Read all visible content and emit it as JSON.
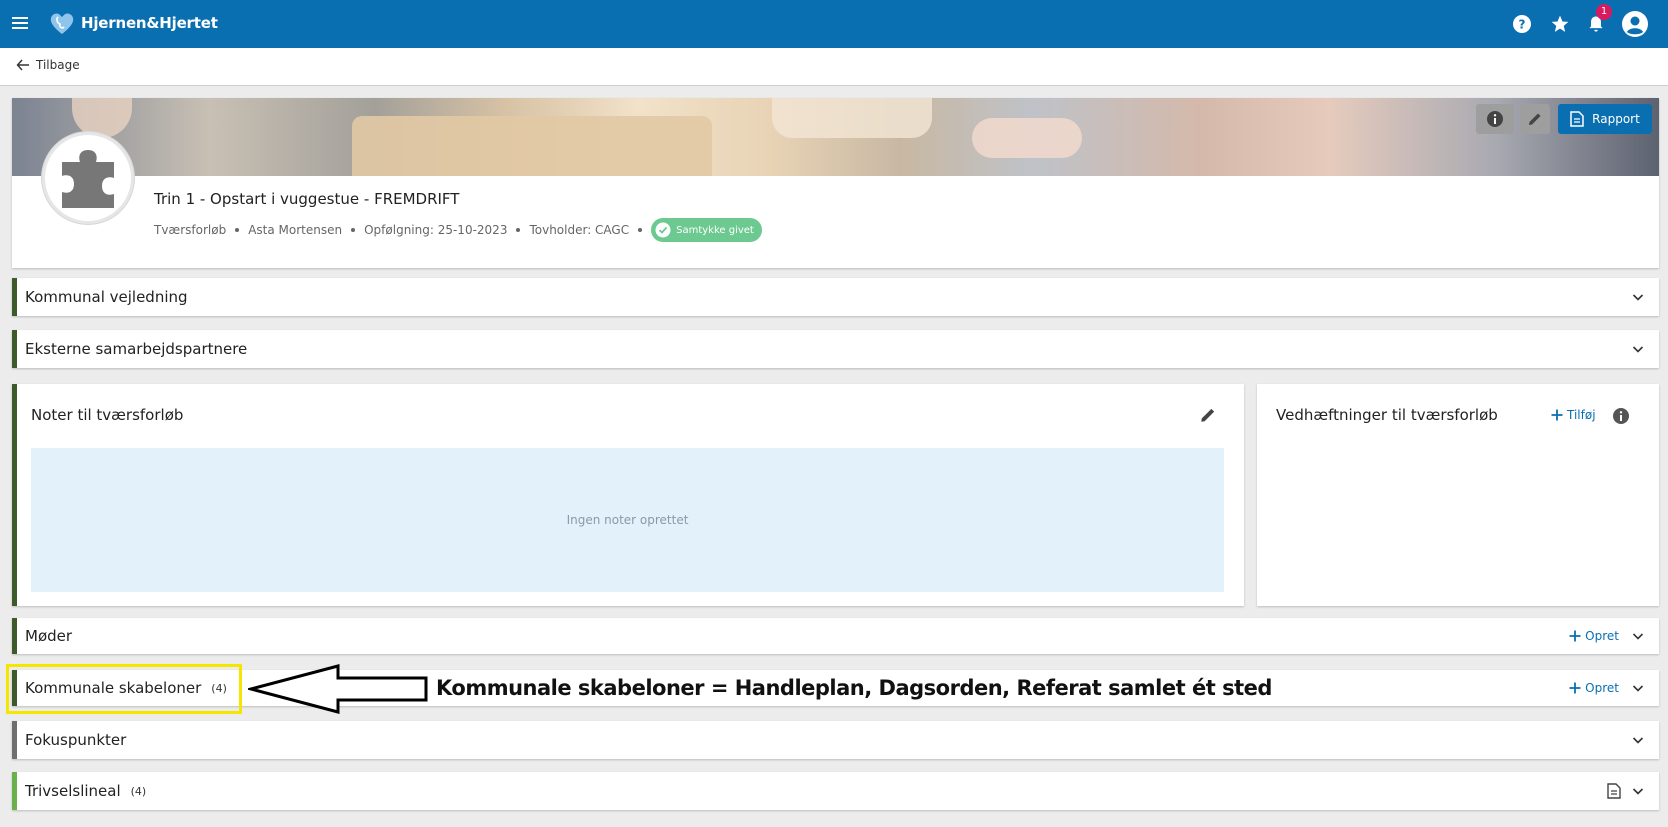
{
  "app": {
    "name": "Hjernen&Hjertet",
    "notification_count": "1"
  },
  "nav": {
    "back_label": "Tilbage"
  },
  "header": {
    "report_label": "Rapport",
    "title": "Trin 1 - Opstart i vuggestue - FREMDRIFT",
    "meta": [
      "Tværsforløb",
      "Asta Mortensen",
      "Opfølgning: 25-10-2023",
      "Tovholder: CAGC"
    ],
    "consent_label": "Samtykke givet"
  },
  "sections": {
    "kommunal_vejledning": "Kommunal vejledning",
    "eksterne": "Eksterne samarbejdspartnere",
    "moder": "Møder",
    "skabeloner": "Kommunale skabeloner",
    "skabeloner_count": "(4)",
    "fokuspunkter": "Fokuspunkter",
    "trivselslineal": "Trivselslineal",
    "trivselslineal_count": "(4)",
    "opret_label": "Opret"
  },
  "notes": {
    "title": "Noter til tværsforløb",
    "empty_text": "Ingen noter oprettet"
  },
  "attachments": {
    "title": "Vedhæftninger til tværsforløb",
    "add_label": "Tilføj"
  },
  "annotation": {
    "text": "Kommunale skabeloner = Handleplan, Dagsorden, Referat  samlet ét sted"
  },
  "colors": {
    "primary": "#0a6fb0",
    "accent_green": "#3d5a2a",
    "highlight": "#f5e600",
    "badge": "#d81b60"
  }
}
